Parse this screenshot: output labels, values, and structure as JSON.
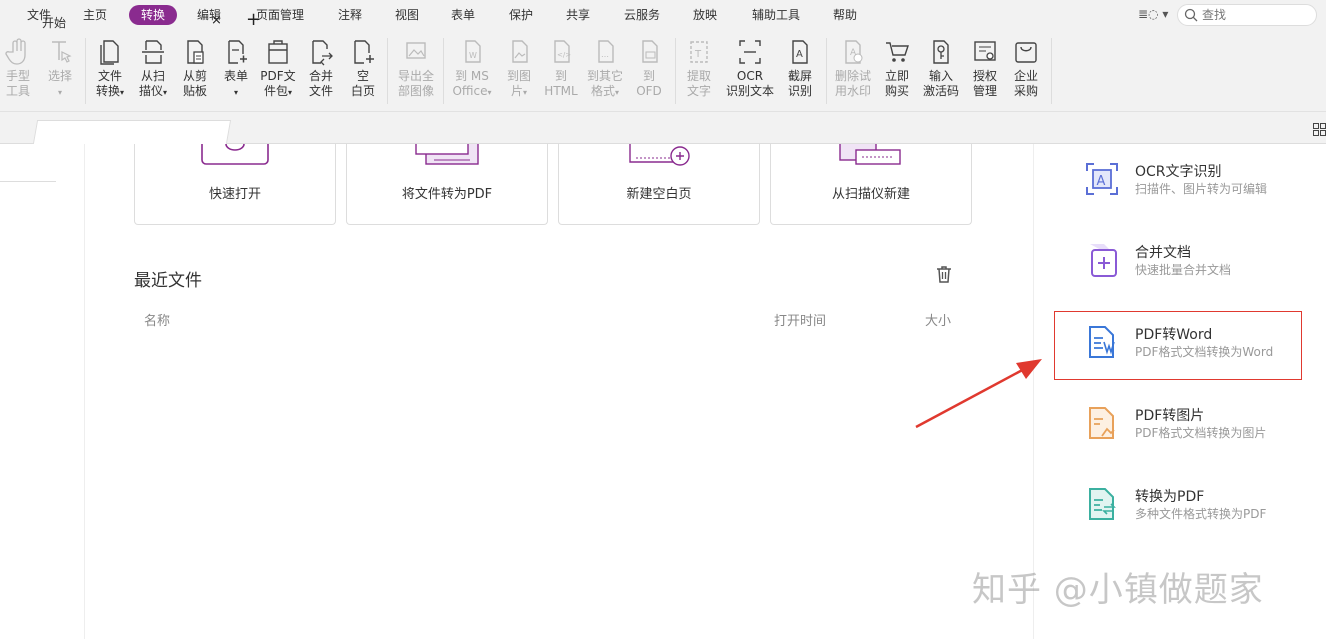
{
  "menu": {
    "items": [
      "文件",
      "主页",
      "转换",
      "编辑",
      "页面管理",
      "注释",
      "视图",
      "表单",
      "保护",
      "共享",
      "云服务",
      "放映",
      "辅助工具",
      "帮助"
    ],
    "active": "转换",
    "search_placeholder": "查找"
  },
  "toolbar": {
    "hand": [
      "手型",
      "工具"
    ],
    "select": [
      "选择"
    ],
    "file_convert": [
      "文件",
      "转换"
    ],
    "scan": [
      "从扫",
      "描仪"
    ],
    "clipboard": [
      "从剪",
      "贴板"
    ],
    "form": [
      "表单"
    ],
    "pdf_package": [
      "PDF文",
      "件包"
    ],
    "merge": [
      "合并",
      "文件"
    ],
    "blank": [
      "空",
      "白页"
    ],
    "export_images": [
      "导出全",
      "部图像"
    ],
    "to_office": [
      "到 MS",
      "Office"
    ],
    "to_image": [
      "到图",
      "片"
    ],
    "to_html": [
      "到",
      "HTML"
    ],
    "to_other": [
      "到其它",
      "格式"
    ],
    "to_ofd": [
      "到",
      "OFD"
    ],
    "extract_text": [
      "提取",
      "文字"
    ],
    "ocr": [
      "OCR",
      "识别文本"
    ],
    "screenshot_ocr": [
      "截屏",
      "识别"
    ],
    "remove_watermark": [
      "删除试",
      "用水印"
    ],
    "buy": [
      "立即",
      "购买"
    ],
    "activate": [
      "输入",
      "激活码"
    ],
    "license": [
      "授权",
      "管理"
    ],
    "enterprise": [
      "企业",
      "采购"
    ]
  },
  "tabs": {
    "current": "开始",
    "close": "×",
    "add": "+"
  },
  "cards": [
    "快速打开",
    "将文件转为PDF",
    "新建空白页",
    "从扫描仪新建"
  ],
  "recent": {
    "title": "最近文件",
    "columns": {
      "name": "名称",
      "time": "打开时间",
      "size": "大小"
    }
  },
  "features": [
    {
      "title": "OCR文字识别",
      "desc": "扫描件、图片转为可编辑",
      "color": "#5b6fd6"
    },
    {
      "title": "合并文档",
      "desc": "快速批量合并文档",
      "color": "#8a5ad6"
    },
    {
      "title": "PDF转Word",
      "desc": "PDF格式文档转换为Word",
      "color": "#3a77d8"
    },
    {
      "title": "PDF转图片",
      "desc": "PDF格式文档转换为图片",
      "color": "#e8a15a"
    },
    {
      "title": "转换为PDF",
      "desc": "多种文件格式转换为PDF",
      "color": "#3bb0a0"
    }
  ],
  "watermark": "知乎 @小镇做题家",
  "colors": {
    "accent": "#8a2b8f",
    "highlight": "#e0392f"
  }
}
